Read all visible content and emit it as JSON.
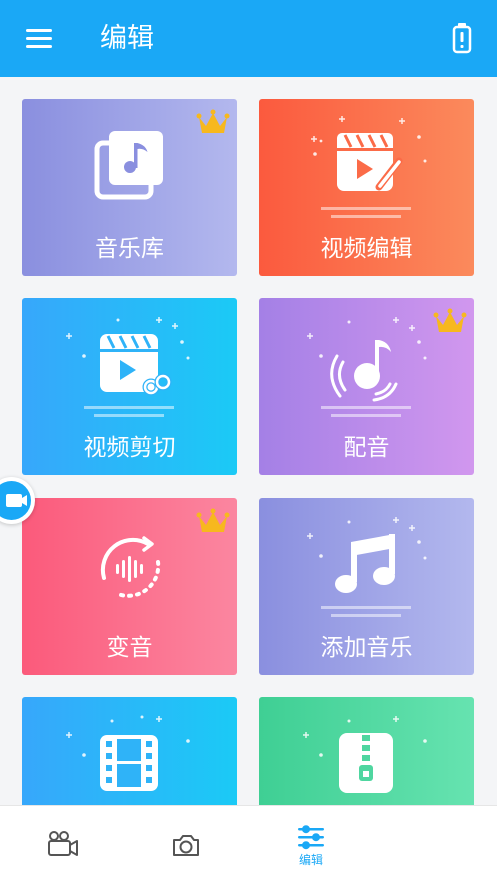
{
  "header": {
    "title": "编辑",
    "menu_icon": "menu-icon",
    "battery_icon": "battery-icon",
    "color": "#1aa8f6"
  },
  "tiles": [
    {
      "label": "音乐库",
      "icon": "music-library-icon",
      "premium": true,
      "gradient": [
        "#8a8fdf",
        "#b3b8ee"
      ]
    },
    {
      "label": "视频编辑",
      "icon": "video-edit-icon",
      "premium": false,
      "gradient": [
        "#fb5a3e",
        "#fb8a5c"
      ]
    },
    {
      "label": "视频剪切",
      "icon": "video-cut-icon",
      "premium": false,
      "gradient": [
        "#37a7fb",
        "#1bcaf6"
      ]
    },
    {
      "label": "配音",
      "icon": "dubbing-icon",
      "premium": true,
      "gradient": [
        "#a480e6",
        "#d197ee"
      ]
    },
    {
      "label": "变音",
      "icon": "voice-change-icon",
      "premium": true,
      "gradient": [
        "#fb5a7b",
        "#fb86a0"
      ]
    },
    {
      "label": "添加音乐",
      "icon": "add-music-icon",
      "premium": false,
      "gradient": [
        "#8a8fdf",
        "#b3b8ee"
      ]
    },
    {
      "label": "",
      "icon": "film-strip-icon",
      "premium": false,
      "gradient": [
        "#37a7fb",
        "#1bcaf6"
      ]
    },
    {
      "label": "",
      "icon": "compress-icon",
      "premium": false,
      "gradient": [
        "#3fcf94",
        "#66e3b0"
      ]
    }
  ],
  "bottom_nav": {
    "items": [
      {
        "icon": "video-camera-icon",
        "label": "",
        "active": false
      },
      {
        "icon": "camera-icon",
        "label": "",
        "active": false
      },
      {
        "icon": "sliders-icon",
        "label": "编辑",
        "active": true
      }
    ],
    "active_color": "#1aa8f6",
    "inactive_color": "#555555"
  },
  "floating_button": {
    "icon": "video-camera-icon"
  }
}
